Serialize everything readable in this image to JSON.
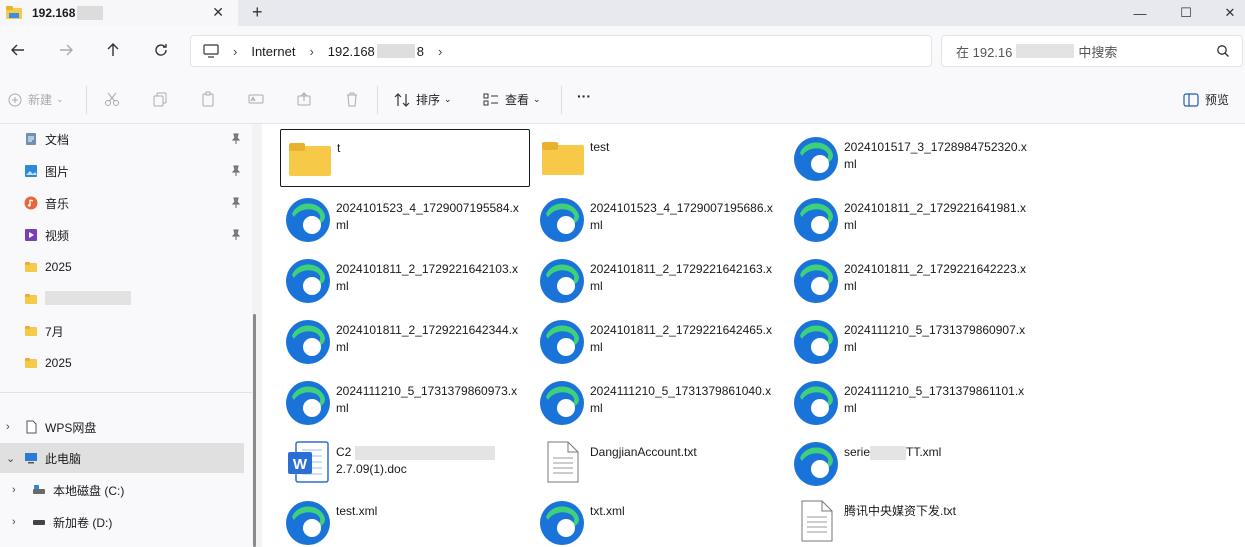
{
  "window": {
    "tab_title": "192.168",
    "new_tab_symbol": "+",
    "close_symbol": "✕",
    "minimize_symbol": "—",
    "maximize_symbol": "☐",
    "window_close_symbol": "✕"
  },
  "navigation": {
    "address_segments": [
      "Internet",
      "192.168",
      "8"
    ],
    "search_placeholder_prefix": "在 192.16",
    "search_placeholder_suffix": "中搜索"
  },
  "command_bar": {
    "new_label": "新建",
    "sort_label": "排序",
    "view_label": "查看",
    "more_label": "···",
    "preview_label": "预览"
  },
  "sidebar": {
    "quick_access": [
      {
        "label": "文档",
        "icon": "document-icon",
        "pinned": true
      },
      {
        "label": "图片",
        "icon": "pictures-icon",
        "pinned": true
      },
      {
        "label": "音乐",
        "icon": "music-icon",
        "pinned": true
      },
      {
        "label": "视频",
        "icon": "video-icon",
        "pinned": true
      },
      {
        "label": "2025",
        "icon": "folder-icon",
        "pinned": false
      },
      {
        "label": "",
        "icon": "folder-icon",
        "pinned": false
      },
      {
        "label": "7月",
        "icon": "folder-icon",
        "pinned": false
      },
      {
        "label": "2025",
        "icon": "folder-icon",
        "pinned": false
      }
    ],
    "wps_label": "WPS网盘",
    "this_pc_label": "此电脑",
    "drive_c_label": "本地磁盘 (C:)",
    "drive_d_label": "新加卷 (D:)"
  },
  "files": [
    {
      "name": "t",
      "type": "folder",
      "selected": true
    },
    {
      "name": "test",
      "type": "folder"
    },
    {
      "name": "2024101517_3_1728984752320.xml",
      "type": "edge"
    },
    {
      "name": "2024101523_4_1729007195584.xml",
      "type": "edge"
    },
    {
      "name": "2024101523_4_1729007195686.xml",
      "type": "edge"
    },
    {
      "name": "2024101811_2_1729221641981.xml",
      "type": "edge"
    },
    {
      "name": "2024101811_2_1729221642103.xml",
      "type": "edge"
    },
    {
      "name": "2024101811_2_1729221642163.xml",
      "type": "edge"
    },
    {
      "name": "2024101811_2_1729221642223.xml",
      "type": "edge"
    },
    {
      "name": "2024101811_2_1729221642344.xml",
      "type": "edge"
    },
    {
      "name": "2024101811_2_1729221642465.xml",
      "type": "edge"
    },
    {
      "name": "2024111210_5_1731379860907.xml",
      "type": "edge"
    },
    {
      "name": "2024111210_5_1731379860973.xml",
      "type": "edge"
    },
    {
      "name": "2024111210_5_1731379861040.xml",
      "type": "edge"
    },
    {
      "name": "2024111210_5_1731379861101.xml",
      "type": "edge"
    },
    {
      "name": "C2",
      "name_line2": "2.7.09(1).doc",
      "type": "word"
    },
    {
      "name": "DangjianAccount.txt",
      "type": "txt"
    },
    {
      "name": "serie",
      "name_tail": "TT.xml",
      "type": "edge"
    },
    {
      "name": "test.xml",
      "type": "edge"
    },
    {
      "name": "txt.xml",
      "type": "edge"
    },
    {
      "name": "腾讯中央媒资下发.txt",
      "type": "txt"
    }
  ],
  "colors": {
    "folder_yellow": "#f7c948",
    "edge_blue": "#1a73d9",
    "edge_green": "#3fd17a",
    "word_blue": "#2b6fd6"
  }
}
